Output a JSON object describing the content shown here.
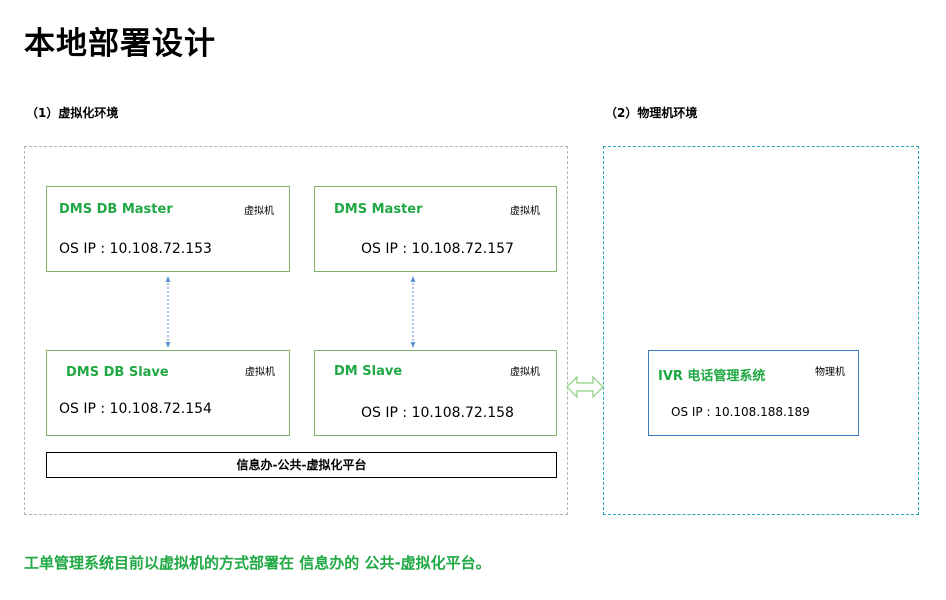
{
  "page": {
    "title": "本地部署设计",
    "footer_note": "工单管理系统目前以虚拟机的方式部署在 信息办的 公共-虚拟化平台。"
  },
  "sections": {
    "virtual": {
      "label": "（1）虚拟化环境"
    },
    "physical": {
      "label": "（2）物理机环境"
    }
  },
  "nodes": {
    "dms_db_master": {
      "name": "DMS DB Master",
      "type": "虚拟机",
      "ip": "OS IP : 10.108.72.153"
    },
    "dms_master": {
      "name": "DMS Master",
      "type": "虚拟机",
      "ip": "OS IP : 10.108.72.157"
    },
    "dms_db_slave": {
      "name": "DMS DB Slave",
      "type": "虚拟机",
      "ip": "OS IP : 10.108.72.154"
    },
    "dm_slave": {
      "name": "DM Slave",
      "type": "虚拟机",
      "ip": "OS IP : 10.108.72.158"
    },
    "ivr": {
      "name": "IVR 电话管理系统",
      "type": "物理机",
      "ip": "OS IP : 10.108.188.189"
    }
  },
  "platform": {
    "label": "信息办-公共-虚拟化平台"
  },
  "colors": {
    "accent_green": "#1fa843",
    "node_border_green": "#7fb36a",
    "node_border_blue": "#3b7bbf",
    "region_border_gray": "#b4b4b4",
    "region_border_teal": "#2aa5b3",
    "connector_blue": "#5b8fd0",
    "link_arrow_green": "#8ccf7e"
  }
}
